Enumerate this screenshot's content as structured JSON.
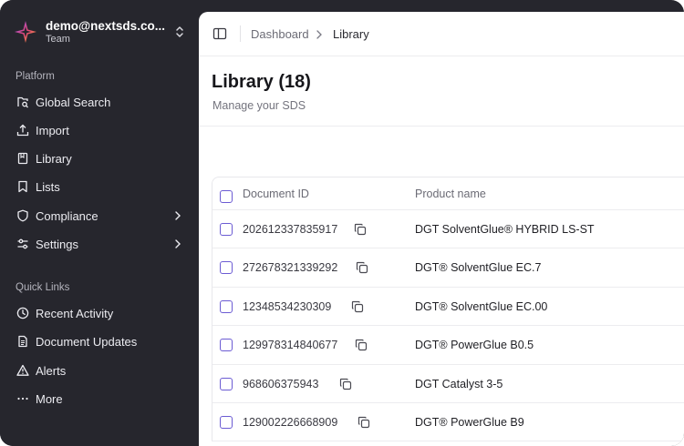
{
  "account": {
    "email": "demo@nextsds.co...",
    "team": "Team"
  },
  "sidebar": {
    "platform_label": "Platform",
    "platform_items": [
      {
        "label": "Global Search",
        "icon": "search-doc-icon"
      },
      {
        "label": "Import",
        "icon": "upload-icon"
      },
      {
        "label": "Library",
        "icon": "book-icon"
      },
      {
        "label": "Lists",
        "icon": "bookmark-icon"
      },
      {
        "label": "Compliance",
        "icon": "shield-icon",
        "has_submenu": true
      },
      {
        "label": "Settings",
        "icon": "sliders-icon",
        "has_submenu": true
      }
    ],
    "quicklinks_label": "Quick Links",
    "quicklinks_items": [
      {
        "label": "Recent Activity",
        "icon": "clock-icon"
      },
      {
        "label": "Document Updates",
        "icon": "document-icon"
      },
      {
        "label": "Alerts",
        "icon": "alert-triangle-icon"
      },
      {
        "label": "More",
        "icon": "ellipsis-icon"
      }
    ]
  },
  "breadcrumb": {
    "parent": "Dashboard",
    "current": "Library"
  },
  "page": {
    "title": "Library (18)",
    "subtitle": "Manage your SDS"
  },
  "table": {
    "columns": [
      "Document ID",
      "Product name"
    ],
    "rows": [
      {
        "id": "202612337835917",
        "product": "DGT SolventGlue® HYBRID LS-ST"
      },
      {
        "id": "272678321339292",
        "product": "DGT® SolventGlue EC.7"
      },
      {
        "id": "12348534230309",
        "product": "DGT® SolventGlue EC.00"
      },
      {
        "id": "129978314840677",
        "product": "DGT® PowerGlue B0.5"
      },
      {
        "id": "968606375943",
        "product": "DGT Catalyst 3-5"
      },
      {
        "id": "129002226668909",
        "product": "DGT® PowerGlue B9"
      }
    ]
  },
  "colors": {
    "sidebar_bg": "#26262d",
    "accent": "#6b5bd3"
  }
}
